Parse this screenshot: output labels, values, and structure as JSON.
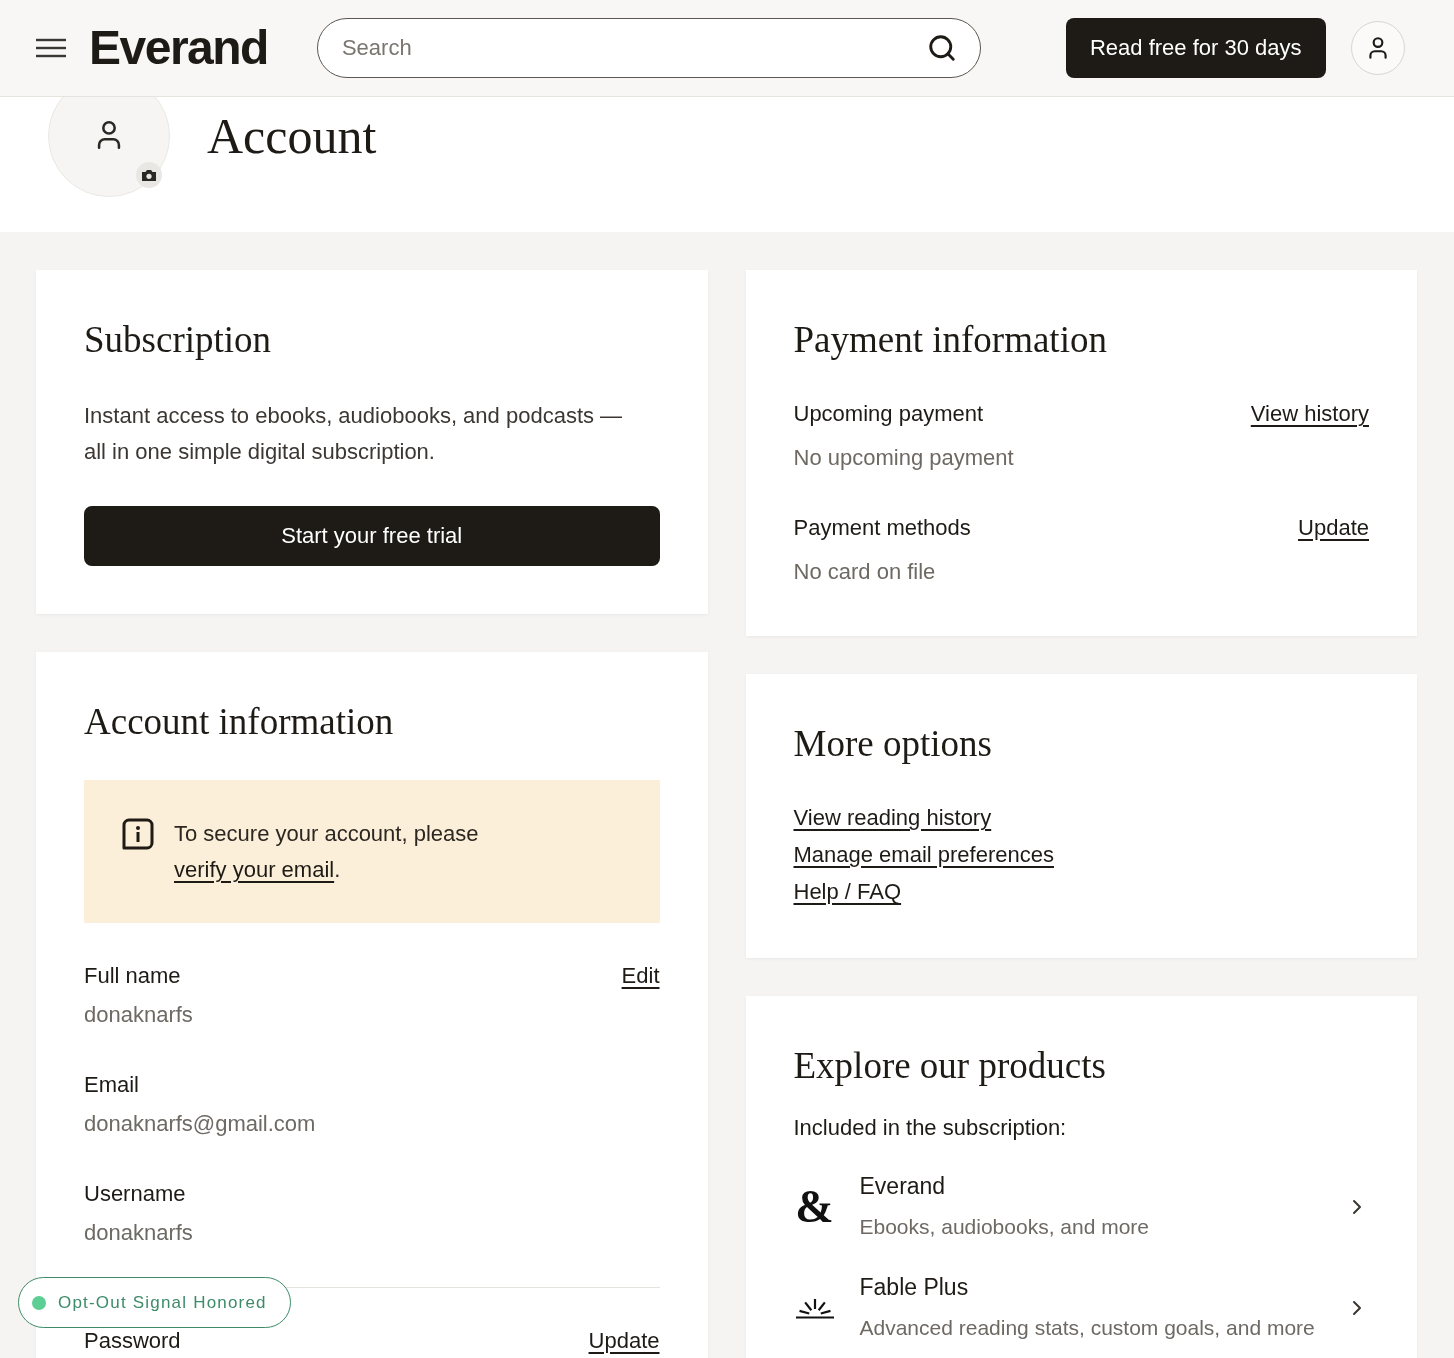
{
  "header": {
    "brand": "Everand",
    "search": {
      "placeholder": "Search"
    },
    "cta": "Read free for 30 days"
  },
  "page_title": "Account",
  "subscription": {
    "title": "Subscription",
    "description": "Instant access to ebooks, audiobooks, and podcasts — all in one simple digital subscription.",
    "button": "Start your free trial"
  },
  "account_information": {
    "title": "Account information",
    "notice": {
      "text": "To secure your account, please",
      "link": "verify your email",
      "after": "."
    },
    "fields": [
      {
        "label": "Full name",
        "value": "donaknarfs",
        "action": "Edit"
      },
      {
        "label": "Email",
        "value": "donaknarfs@gmail.com"
      },
      {
        "label": "Username",
        "value": "donaknarfs"
      }
    ],
    "password": {
      "label": "Password",
      "action": "Update"
    }
  },
  "payment_information": {
    "title": "Payment information",
    "sections": [
      {
        "label": "Upcoming payment",
        "value": "No upcoming payment",
        "action": "View history"
      },
      {
        "label": "Payment methods",
        "value": "No card on file",
        "action": "Update"
      }
    ]
  },
  "more_options": {
    "title": "More options",
    "links": [
      "View reading history",
      "Manage email preferences",
      "Help / FAQ"
    ]
  },
  "explore": {
    "title": "Explore our products",
    "subtitle": "Included in the subscription:",
    "products": [
      {
        "kind": "glyph",
        "glyph": "&",
        "name": "Everand",
        "description": "Ebooks, audiobooks, and more"
      },
      {
        "kind": "sunburst",
        "name": "Fable Plus",
        "description": "Advanced reading stats, custom goals, and more"
      }
    ]
  },
  "privacy_badge": {
    "text": "Opt-Out Signal Honored"
  }
}
